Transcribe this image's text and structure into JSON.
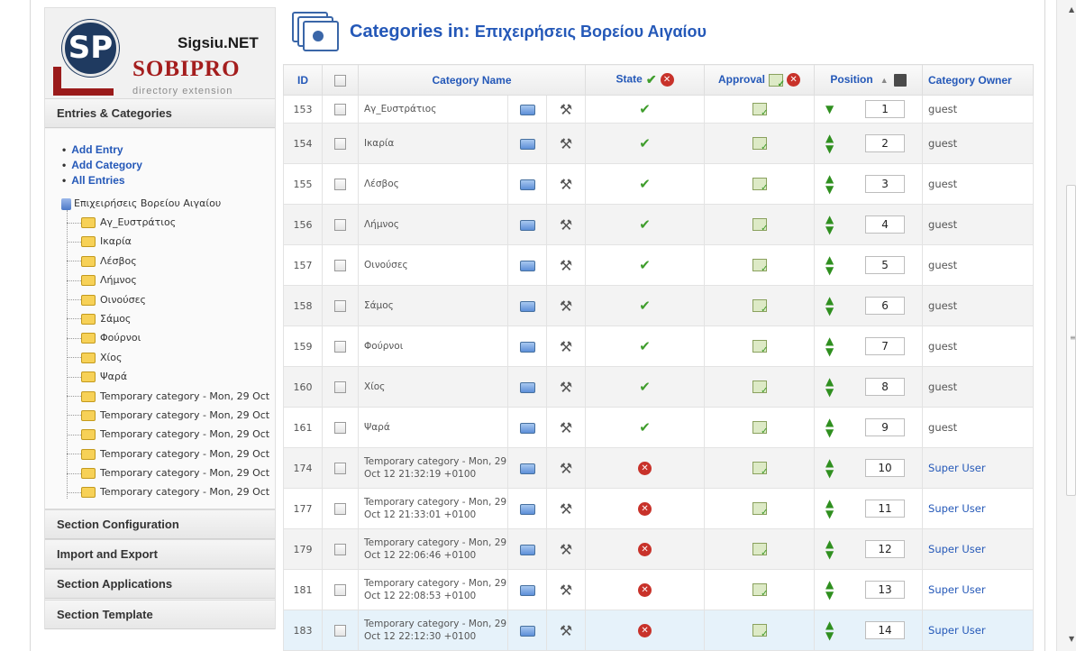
{
  "sidebar": {
    "logo": {
      "monogram": "SP",
      "sigsiu": "Sigsiu.NET",
      "sobipro": "SOBIPRO",
      "tagline": "directory extension"
    },
    "entries_panel": {
      "title": "Entries & Categories",
      "links": [
        "Add Entry",
        "Add Category",
        "All Entries"
      ],
      "tree_root": "Επιχειρήσεις Βορείου Αιγαίου",
      "tree_items": [
        "Αγ_Ευστράτιος",
        "Ικαρία",
        "Λέσβος",
        "Λήμνος",
        "Οινούσες",
        "Σάμος",
        "Φούρνοι",
        "Χίος",
        "Ψαρά",
        "Temporary category - Mon, 29 Oct",
        "Temporary category - Mon, 29 Oct",
        "Temporary category - Mon, 29 Oct",
        "Temporary category - Mon, 29 Oct",
        "Temporary category - Mon, 29 Oct",
        "Temporary category - Mon, 29 Oct"
      ]
    },
    "collapsed_panels": [
      "Section Configuration",
      "Import and Export",
      "Section Applications",
      "Section Template"
    ]
  },
  "main": {
    "title_prefix": "Categories in:",
    "title_section": "Επιχειρήσεις Βορείου Αιγαίου",
    "columns": {
      "id": "ID",
      "name": "Category Name",
      "state": "State",
      "approval": "Approval",
      "position": "Position",
      "owner": "Category Owner"
    },
    "rows": [
      {
        "id": "153",
        "name": "Αγ_Ευστράτιος",
        "state": "published",
        "position": "1",
        "owner": "guest",
        "up": false,
        "down": true
      },
      {
        "id": "154",
        "name": "Ικαρία",
        "state": "published",
        "position": "2",
        "owner": "guest",
        "up": true,
        "down": true
      },
      {
        "id": "155",
        "name": "Λέσβος",
        "state": "published",
        "position": "3",
        "owner": "guest",
        "up": true,
        "down": true
      },
      {
        "id": "156",
        "name": "Λήμνος",
        "state": "published",
        "position": "4",
        "owner": "guest",
        "up": true,
        "down": true
      },
      {
        "id": "157",
        "name": "Οινούσες",
        "state": "published",
        "position": "5",
        "owner": "guest",
        "up": true,
        "down": true
      },
      {
        "id": "158",
        "name": "Σάμος",
        "state": "published",
        "position": "6",
        "owner": "guest",
        "up": true,
        "down": true
      },
      {
        "id": "159",
        "name": "Φούρνοι",
        "state": "published",
        "position": "7",
        "owner": "guest",
        "up": true,
        "down": true
      },
      {
        "id": "160",
        "name": "Χίος",
        "state": "published",
        "position": "8",
        "owner": "guest",
        "up": true,
        "down": true
      },
      {
        "id": "161",
        "name": "Ψαρά",
        "state": "published",
        "position": "9",
        "owner": "guest",
        "up": true,
        "down": true
      },
      {
        "id": "174",
        "name": "Temporary category - Mon, 29 Oct 12 21:32:19 +0100",
        "state": "unpublished",
        "position": "10",
        "owner": "Super User",
        "up": true,
        "down": true
      },
      {
        "id": "177",
        "name": "Temporary category - Mon, 29 Oct 12 21:33:01 +0100",
        "state": "unpublished",
        "position": "11",
        "owner": "Super User",
        "up": true,
        "down": true
      },
      {
        "id": "179",
        "name": "Temporary category - Mon, 29 Oct 12 22:06:46 +0100",
        "state": "unpublished",
        "position": "12",
        "owner": "Super User",
        "up": true,
        "down": true
      },
      {
        "id": "181",
        "name": "Temporary category - Mon, 29 Oct 12 22:08:53 +0100",
        "state": "unpublished",
        "position": "13",
        "owner": "Super User",
        "up": true,
        "down": true
      },
      {
        "id": "183",
        "name": "Temporary category - Mon, 29 Oct 12 22:12:30 +0100",
        "state": "unpublished",
        "position": "14",
        "owner": "Super User",
        "up": true,
        "down": true
      }
    ]
  },
  "colors": {
    "link_blue": "#2458b8",
    "brand_red": "#a41d1d",
    "publish_green": "#3f9d2c",
    "unpublish_red": "#c8322a"
  },
  "icons": {
    "folder": "folder-icon",
    "edit": "wrench-icon",
    "published": "checkmark-icon",
    "unpublished": "x-circle-icon",
    "approval": "approve-icon",
    "save_order": "save-disk-icon"
  }
}
